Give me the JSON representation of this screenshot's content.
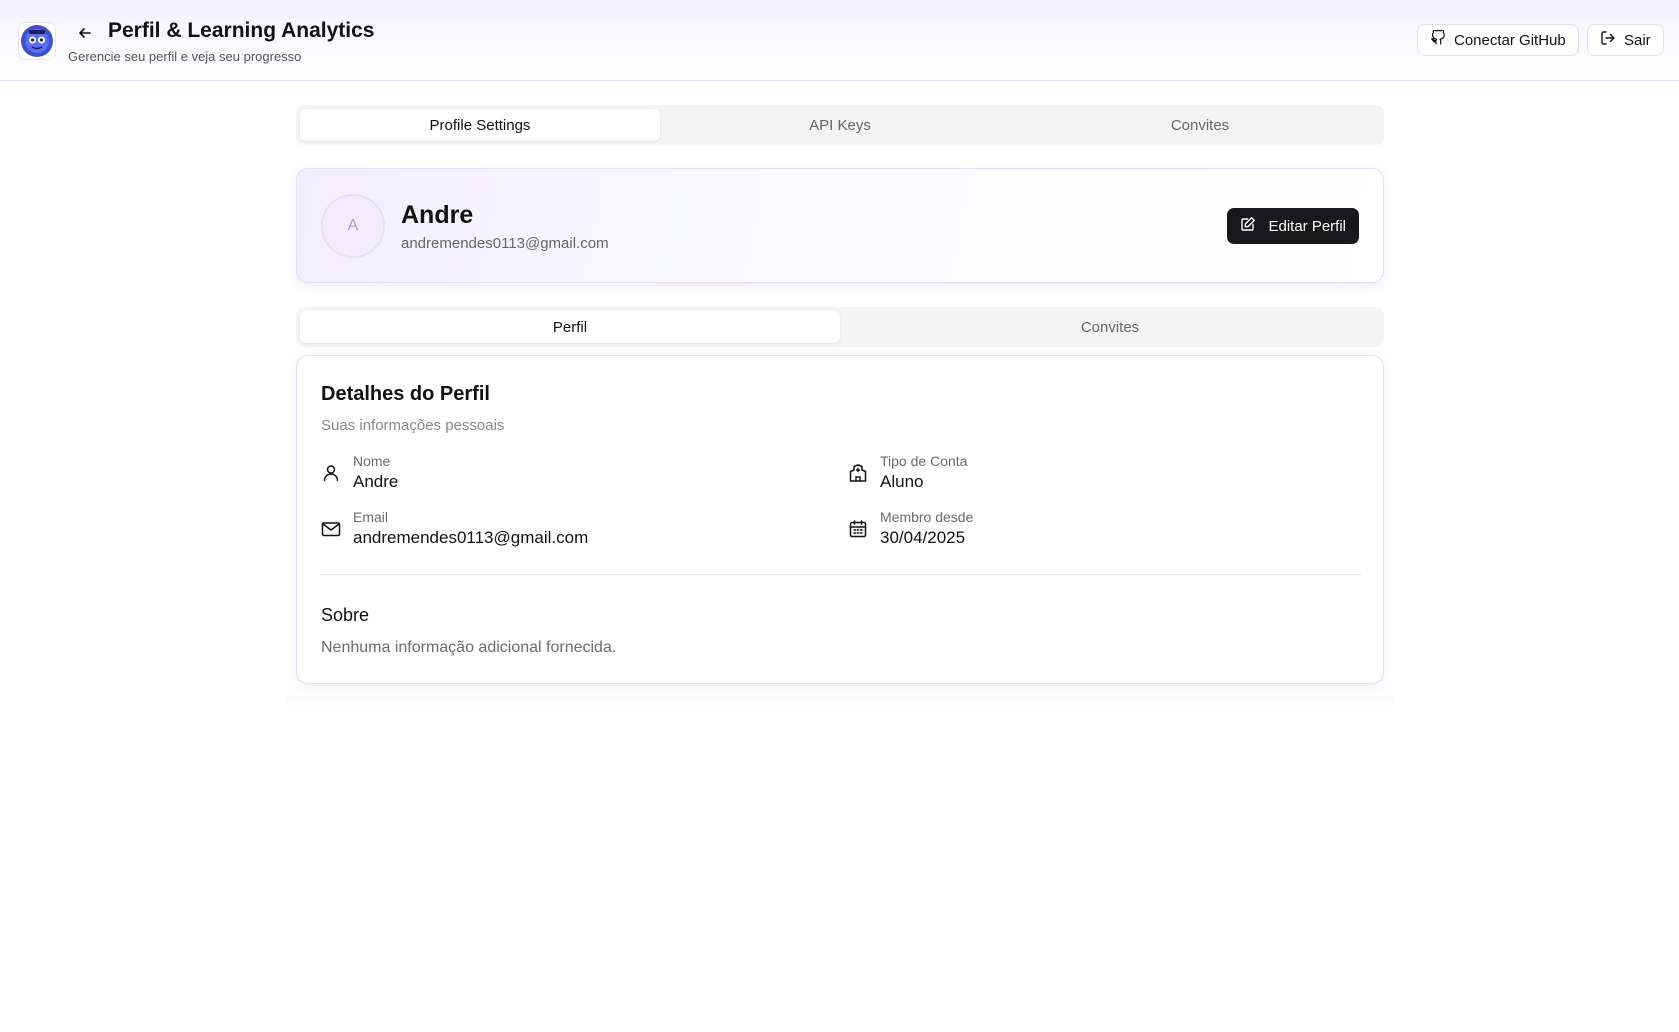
{
  "header": {
    "title": "Perfil & Learning Analytics",
    "subtitle": "Gerencie seu perfil e veja seu progresso",
    "github_label": "Conectar GitHub",
    "logout_label": "Sair"
  },
  "top_tabs": [
    {
      "label": "Profile Settings",
      "active": true
    },
    {
      "label": "API Keys",
      "active": false
    },
    {
      "label": "Convites",
      "active": false
    }
  ],
  "profile": {
    "initial": "A",
    "name": "Andre",
    "email": "andremendes0113@gmail.com",
    "edit_label": "Editar Perfil"
  },
  "sub_tabs": [
    {
      "label": "Perfil",
      "active": true
    },
    {
      "label": "Convites",
      "active": false
    }
  ],
  "details": {
    "title": "Detalhes do Perfil",
    "subtitle": "Suas informações pessoais",
    "fields": {
      "name": {
        "label": "Nome",
        "value": "Andre",
        "icon": "user-icon"
      },
      "account_type": {
        "label": "Tipo de Conta",
        "value": "Aluno",
        "icon": "building-icon"
      },
      "email": {
        "label": "Email",
        "value": "andremendes0113@gmail.com",
        "icon": "mail-icon"
      },
      "member_since": {
        "label": "Membro desde",
        "value": "30/04/2025",
        "icon": "calendar-icon"
      }
    },
    "about_title": "Sobre",
    "about_text": "Nenhuma informação adicional fornecida."
  },
  "colors": {
    "accent": "#a897e6",
    "primary_button": "#18181b",
    "header_tint": "#f4f1ff"
  }
}
